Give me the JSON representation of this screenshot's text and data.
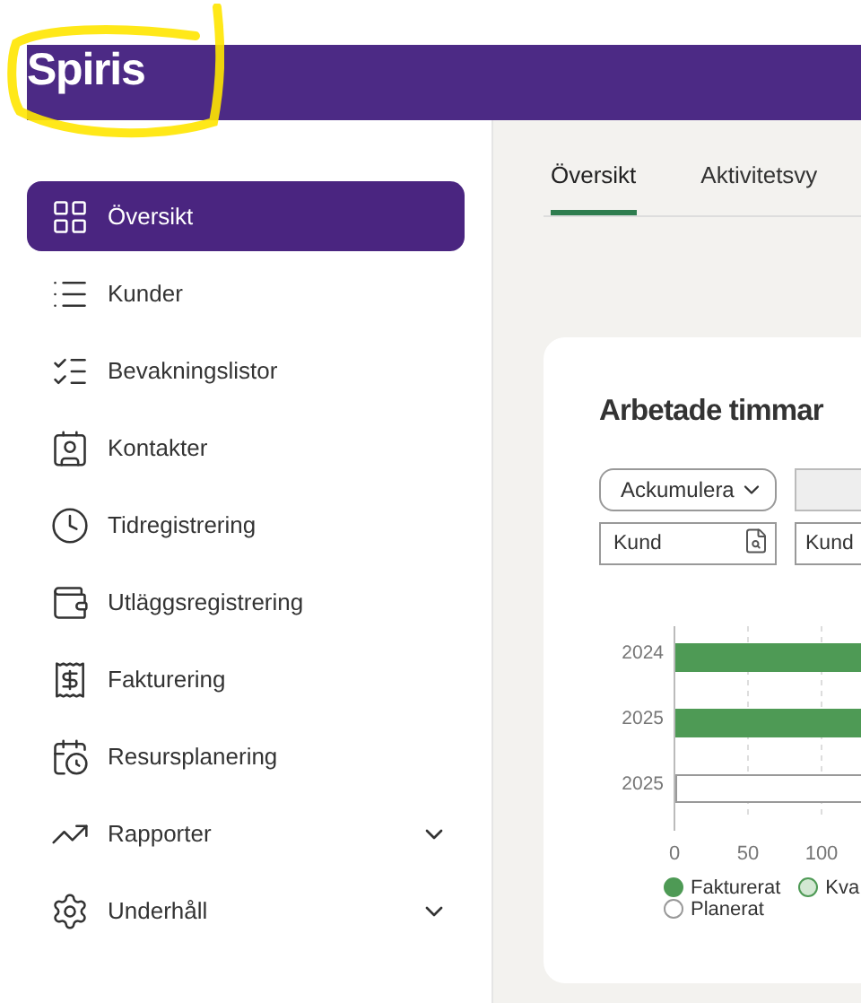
{
  "header": {
    "logo": "Spiris"
  },
  "sidebar": {
    "items": [
      {
        "label": "Översikt",
        "selected": true
      },
      {
        "label": "Kunder",
        "selected": false
      },
      {
        "label": "Bevakningslistor",
        "selected": false
      },
      {
        "label": "Kontakter",
        "selected": false
      },
      {
        "label": "Tidregistrering",
        "selected": false
      },
      {
        "label": "Utläggsregistrering",
        "selected": false
      },
      {
        "label": "Fakturering",
        "selected": false
      },
      {
        "label": "Resursplanering",
        "selected": false
      },
      {
        "label": "Rapporter",
        "selected": false,
        "expanded": false
      },
      {
        "label": "Underhåll",
        "selected": false,
        "expanded": false
      }
    ]
  },
  "tabs": [
    {
      "label": "Översikt",
      "selected": true
    },
    {
      "label": "Aktivitetsvy",
      "selected": false
    }
  ],
  "card": {
    "title": "Arbetade timmar",
    "select": {
      "value": "Ackumulera"
    },
    "fields": [
      {
        "placeholder": "Kund",
        "kind": "search"
      },
      {
        "placeholder": "Kund",
        "kind": "plain"
      }
    ],
    "chart": {
      "rows": [
        {
          "label": "2024",
          "color": "#4e9a55"
        },
        {
          "label": "2025",
          "color": "#4e9a55"
        },
        {
          "label": "2025",
          "color": "#ffffff"
        }
      ],
      "ticks": [
        "0",
        "50",
        "100"
      ],
      "legend": [
        {
          "name": "Fakturerat",
          "color": "#4e9a55"
        },
        {
          "name": "Kva",
          "color": "#d3e8d3"
        },
        {
          "name": "Planerat",
          "color": "#ffffff"
        }
      ]
    }
  }
}
